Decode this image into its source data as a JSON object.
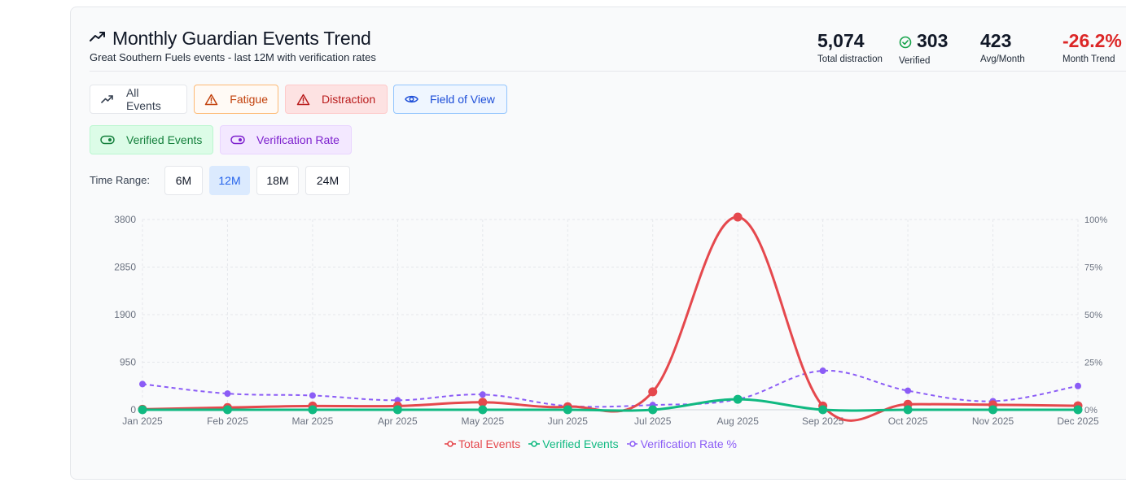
{
  "header": {
    "title": "Monthly Guardian Events Trend",
    "subtitle": "Great Southern Fuels events - last 12M with verification rates"
  },
  "stats": [
    {
      "value": "5,074",
      "label": "Total distraction"
    },
    {
      "value": "303",
      "label": "Verified"
    },
    {
      "value": "423",
      "label": "Avg/Month"
    },
    {
      "value": "-26.2%",
      "label": "Month Trend"
    }
  ],
  "filters": {
    "all": "All Events",
    "fatigue": "Fatigue",
    "distraction": "Distraction",
    "fov": "Field of View",
    "verified": "Verified Events",
    "rate": "Verification Rate"
  },
  "time_range": {
    "label": "Time Range:",
    "options": [
      "6M",
      "12M",
      "18M",
      "24M"
    ],
    "selected": "12M"
  },
  "colors": {
    "total": "#e5484d",
    "verified": "#10b981",
    "rate": "#8b5cf6"
  },
  "chart_data": {
    "type": "line",
    "categories": [
      "Jan 2025",
      "Feb 2025",
      "Mar 2025",
      "Apr 2025",
      "May 2025",
      "Jun 2025",
      "Jul 2025",
      "Aug 2025",
      "Sep 2025",
      "Oct 2025",
      "Nov 2025",
      "Dec 2025"
    ],
    "y_left": {
      "ticks": [
        "0",
        "950",
        "1900",
        "2850",
        "3800"
      ],
      "ylim": [
        0,
        3800
      ]
    },
    "y_right": {
      "ticks": [
        "0%",
        "25%",
        "50%",
        "75%",
        "100%"
      ],
      "ylim": [
        0,
        100
      ]
    },
    "grid": true,
    "legend_position": "bottom",
    "series": [
      {
        "name": "Total Events",
        "axis": "left",
        "values": [
          10,
          45,
          75,
          75,
          150,
          60,
          360,
          3850,
          75,
          110,
          100,
          80
        ]
      },
      {
        "name": "Verified Events",
        "axis": "left",
        "values": [
          0,
          0,
          0,
          0,
          0,
          0,
          0,
          210,
          0,
          0,
          0,
          0
        ]
      },
      {
        "name": "Verification Rate %",
        "axis": "right",
        "values": [
          13.5,
          8.5,
          7.5,
          5,
          8,
          2,
          2.5,
          5.5,
          20.5,
          10,
          4.5,
          12.5
        ]
      }
    ]
  }
}
